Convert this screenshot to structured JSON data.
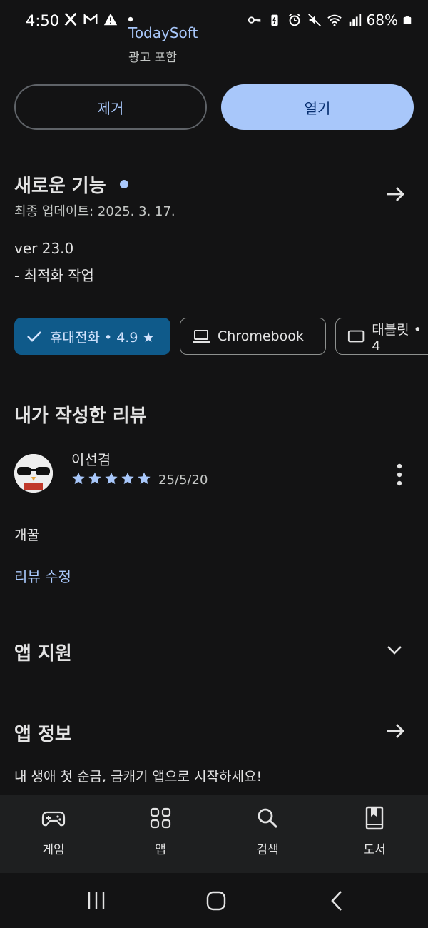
{
  "status_bar": {
    "time": "4:50",
    "battery": "68%",
    "left_icons": [
      "x-icon",
      "gmail-icon",
      "warning-icon",
      "dot-icon"
    ],
    "right_icons": [
      "key-icon",
      "battery-saver-icon",
      "alarm-icon",
      "mute-icon",
      "wifi-icon",
      "signal-icon",
      "battery-icon"
    ]
  },
  "app": {
    "developer": "TodaySoft",
    "ads_note": "광고 포함"
  },
  "actions": {
    "remove_label": "제거",
    "open_label": "열기"
  },
  "whats_new": {
    "title": "새로운 기능",
    "updated": "최종 업데이트: 2025. 3. 17.",
    "version": "ver 23.0",
    "notes": "- 최적화 작업"
  },
  "device_chips": [
    {
      "label": "휴대전화 • 4.9 ★",
      "selected": true,
      "icon": "check-icon"
    },
    {
      "label": "Chromebook",
      "selected": false,
      "icon": "laptop-icon"
    },
    {
      "label": "태블릿 • 4",
      "selected": false,
      "icon": "tablet-icon"
    }
  ],
  "my_review": {
    "title": "내가 작성한 리뷰",
    "author": "이선겸",
    "rating": 5,
    "date": "25/5/20",
    "text": "개꿀",
    "edit_label": "리뷰 수정"
  },
  "app_support": {
    "title": "앱 지원"
  },
  "app_info": {
    "title": "앱 정보",
    "description": "내 생애 첫 순금, 금캐기 앱으로 시작하세요!"
  },
  "bottom_nav": [
    {
      "label": "게임",
      "icon": "gamepad-icon"
    },
    {
      "label": "앱",
      "icon": "apps-grid-icon"
    },
    {
      "label": "검색",
      "icon": "search-icon"
    },
    {
      "label": "도서",
      "icon": "book-icon"
    }
  ],
  "colors": {
    "background": "#131314",
    "accent": "#a8c7fa",
    "selected_chip": "#0f5a8a"
  }
}
